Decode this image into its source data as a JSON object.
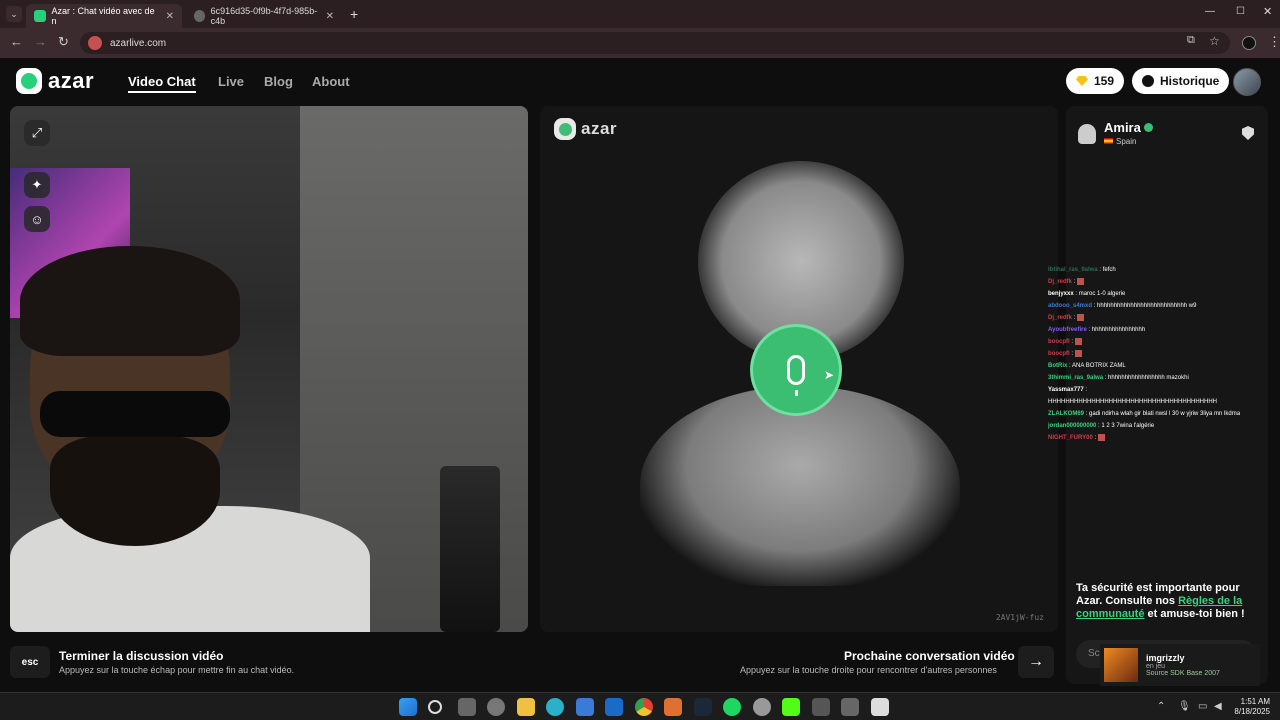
{
  "browser": {
    "tabs": [
      {
        "label": "Azar : Chat vidéo avec de n",
        "active": true
      },
      {
        "label": "6c916d35-0f9b-4f7d-985b-c4b",
        "active": false
      }
    ],
    "url": "azarlive.com"
  },
  "header": {
    "logo": "azar",
    "nav": [
      "Video Chat",
      "Live",
      "Blog",
      "About"
    ],
    "gems": "159",
    "history_label": "Historique"
  },
  "partner": {
    "logo": "azar",
    "id": "2AV1jW-fuz"
  },
  "profile": {
    "name": "Amira",
    "country": "Spain"
  },
  "safety": {
    "text_before": "Ta sécurité est importante pour Azar. Consulte nos ",
    "link": "Règles de la communauté",
    "text_after": " et amuse-toi bien !"
  },
  "chat_input_placeholder": "Sc",
  "stream_chat": [
    {
      "user": "Ibtihal_ras_9alwa",
      "text": ": fefch",
      "color": "#2c6b5b"
    },
    {
      "user": "Dj_redfk",
      "text": ":",
      "color": "#d43a4a",
      "emote": true
    },
    {
      "user": "benjyxxx",
      "text": ": maroc 1-0 algerie",
      "color": "#ffffff"
    },
    {
      "user": "abdooo_s4mxd",
      "text": ": hhhhhhhhhhhhhhhhhhhhhhhhhhh w9",
      "color": "#3a7bd5"
    },
    {
      "user": "Dj_redfk",
      "text": ":",
      "color": "#d43a4a",
      "emote": true
    },
    {
      "user": "Ayoubfreefire",
      "text": ": hhhhhhhhhhhhhhhh",
      "color": "#8a5cf5"
    },
    {
      "user": "boocpfl",
      "text": ":",
      "color": "#d43a4a",
      "emote": true
    },
    {
      "user": "boocpfl",
      "text": ":",
      "color": "#d43a4a",
      "emote": true
    },
    {
      "user": "BotRix",
      "text": ": ANA BOTRIX ZAML",
      "color": "#3bd17f"
    },
    {
      "user": "3thimmi_ras_9alwa",
      "text": ": hhhhhhhhhhhhhhhhh mazokhi",
      "color": "#3bd17f"
    },
    {
      "user": "Yassmax777",
      "text": ":",
      "color": "#ffffff"
    },
    {
      "user": "",
      "text": "HHHHHHHHHHHHHHHHHHHHHHHHHHHHHHHHHHHHHHH",
      "color": "#ffffff"
    },
    {
      "user": "ZLALKOM69",
      "text": ": gadi ndirha wlah gir blati nwsl l 30 w yjriw 3liya mn lkdma",
      "color": "#3bd17f"
    },
    {
      "user": "jordan000000000",
      "text": ": 1 2 3 7wina l'algérie",
      "color": "#3bd17f"
    },
    {
      "user": "NIGHT_FURY00",
      "text": ":",
      "color": "#d43a4a",
      "emote": true
    }
  ],
  "notification": {
    "name": "imgrizzly",
    "status": "en jeu",
    "game": "Source SDK Base 2007"
  },
  "actions": {
    "esc_key": "esc",
    "end_title": "Terminer la discussion vidéo",
    "end_sub": "Appuyez sur la touche échap pour mettre fin au chat vidéo.",
    "next_title": "Prochaine conversation vidéo",
    "next_sub": "Appuyez sur la touche droite pour rencontrer d'autres personnes"
  },
  "taskbar": {
    "time": "1:51 AM",
    "date": "8/18/2025"
  },
  "colors": {
    "accent": "#3bbd72",
    "link": "#3bd17f"
  }
}
